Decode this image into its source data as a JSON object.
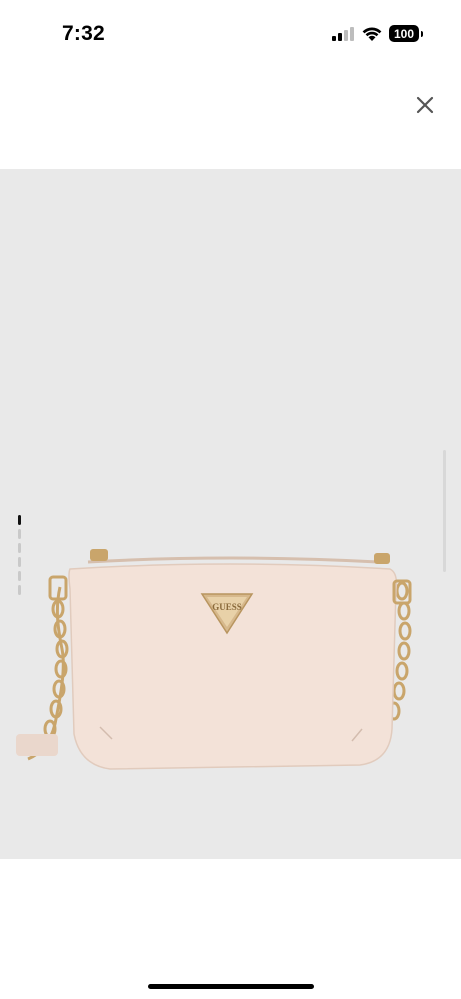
{
  "status_bar": {
    "time": "7:32",
    "battery": "100"
  },
  "product_image": {
    "brand_logo_text": "GUESS",
    "background_color": "#e9e9e9",
    "bag_color": "#f3e2d8",
    "hardware_color": "#c9a56b"
  },
  "pager": {
    "total": 6,
    "current": 1
  },
  "icons": {
    "close": "close-icon",
    "signal": "cellular-signal-icon",
    "wifi": "wifi-icon",
    "battery": "battery-icon"
  }
}
